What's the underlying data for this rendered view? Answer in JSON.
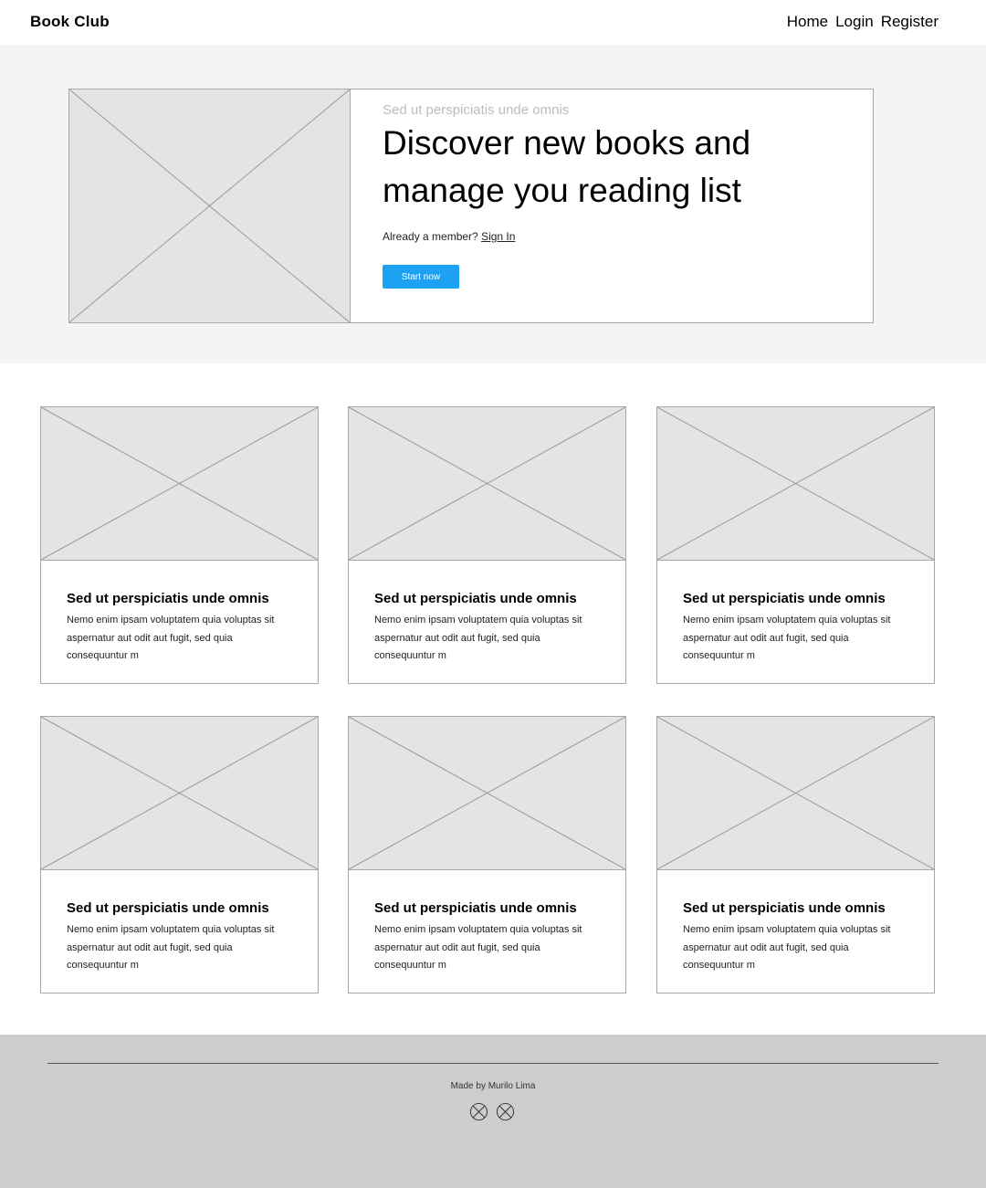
{
  "header": {
    "brand": "Book Club",
    "nav": [
      "Home",
      "Login",
      "Register"
    ]
  },
  "hero": {
    "eyebrow": "Sed ut perspiciatis unde omnis",
    "title": "Discover new books and manage you reading list",
    "member_prompt": "Already a member?",
    "sign_in": "Sign In",
    "cta": "Start now"
  },
  "cards": [
    {
      "title": "Sed ut perspiciatis unde omnis",
      "text": "Nemo enim ipsam voluptatem quia voluptas sit aspernatur aut odit aut fugit, sed quia consequuntur m"
    },
    {
      "title": "Sed ut perspiciatis unde omnis",
      "text": "Nemo enim ipsam voluptatem quia voluptas sit aspernatur aut odit aut fugit, sed quia consequuntur m"
    },
    {
      "title": "Sed ut perspiciatis unde omnis",
      "text": "Nemo enim ipsam voluptatem quia voluptas sit aspernatur aut odit aut fugit, sed quia consequuntur m"
    },
    {
      "title": "Sed ut perspiciatis unde omnis",
      "text": "Nemo enim ipsam voluptatem quia voluptas sit aspernatur aut odit aut fugit, sed quia consequuntur m"
    },
    {
      "title": "Sed ut perspiciatis unde omnis",
      "text": "Nemo enim ipsam voluptatem quia voluptas sit aspernatur aut odit aut fugit, sed quia consequuntur m"
    },
    {
      "title": "Sed ut perspiciatis unde omnis",
      "text": "Nemo enim ipsam voluptatem quia voluptas sit aspernatur aut odit aut fugit, sed quia consequuntur m"
    }
  ],
  "footer": {
    "credit": "Made by Murilo Lima",
    "social_icons": [
      "placeholder-circle-icon",
      "placeholder-circle-icon"
    ]
  },
  "colors": {
    "accent": "#1da1f2",
    "hero_bg": "#f4f4f4",
    "footer_bg": "#cdcdcd",
    "placeholder": "#e4e4e4"
  }
}
